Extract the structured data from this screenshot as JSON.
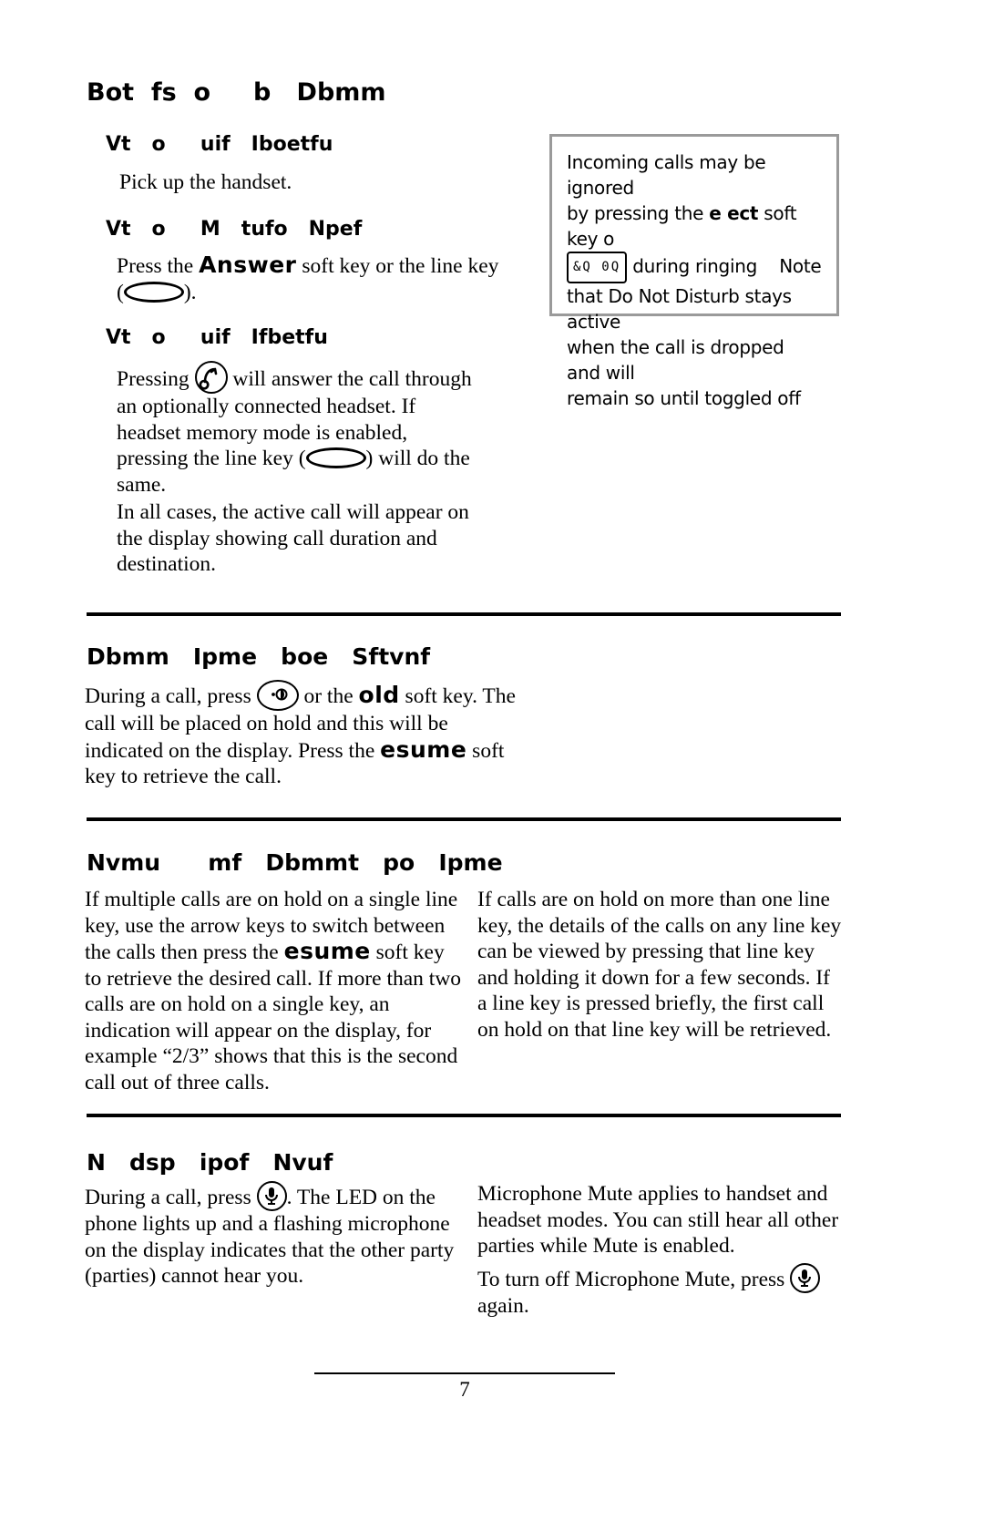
{
  "document": {
    "page_number": "7",
    "sections": [
      {
        "id": "answer-call",
        "heading": "Bot  fs  o     b   Dbmm",
        "subsections": [
          {
            "heading": "Vt   o     uif   Iboetfu",
            "body": "Pick up the handset."
          },
          {
            "heading": "Vt   o     M   tufo   Npef",
            "body_pre": "Press the ",
            "softkey": "Answer",
            "body_post": " soft key or the line key",
            "body_line2_post": ")."
          },
          {
            "heading": "Vt   o     uif   Ifbetfu",
            "body_pre": "Pressing ",
            "body_post": " will answer the call through an optionally connected headset.  If headset memory mode is enabled, pressing the line key (",
            "body_post2": ") will do the same.",
            "body2": "In all cases, the active call will appear on the display showing call duration and destination."
          }
        ]
      },
      {
        "id": "call-hold-resume",
        "heading": "Dbmm   Ipme   boe   Sftvnf",
        "body_pre": "During a call, press ",
        "body_mid": " or the ",
        "softkey1": "old",
        "body_mid2": " soft key.  The call will be placed on hold and this will be indicated on the display.  Press the ",
        "softkey2": "esume",
        "body_end": " soft key to retrieve the call."
      },
      {
        "id": "multiple-calls-on-hold",
        "heading": "Nvmu      mf   Dbmmt   po   Ipme",
        "column_left_pre": "If multiple calls are on hold on a single line key, use the arrow keys to switch between the calls then press the ",
        "column_left_softkey": "esume",
        "column_left_post": " soft key to retrieve the desired call.  If more than two calls are on hold on a single key, an indication will appear on the display, for example “2/3” shows that this is the second call out of three calls.",
        "column_right": "If calls are on hold on more than one line key, the details of the calls on any line key can be viewed by pressing that line key and holding it down for a few seconds.  If a line key is pressed briefly, the first call on hold on that line key will be retrieved."
      },
      {
        "id": "microphone-mute",
        "heading": "N   dsp   ipof   Nvuf",
        "column_left_pre": "During a call, press ",
        "column_left_post": ".  The LED on the phone lights up and a flashing microphone on the display indicates that the other party (parties) cannot hear you.",
        "column_right_1": "Microphone Mute applies to handset and headset modes.  You can still hear all other parties while Mute is enabled.",
        "column_right_2_pre": "To turn off Microphone Mute, press ",
        "column_right_2_post": " again."
      }
    ],
    "note_box": {
      "line1": "Incoming calls may be ignored",
      "line2_pre": "by pressing the ",
      "line2_key": "e   ect",
      "line2_post": " soft key o",
      "line3_lcd": "&Q  0Q",
      "line3_mid": " during ringing",
      "line3_end": "Note",
      "line4": "that Do Not Disturb stays active",
      "line5": "when the call is dropped and will",
      "line6": "remain so until toggled off"
    }
  }
}
